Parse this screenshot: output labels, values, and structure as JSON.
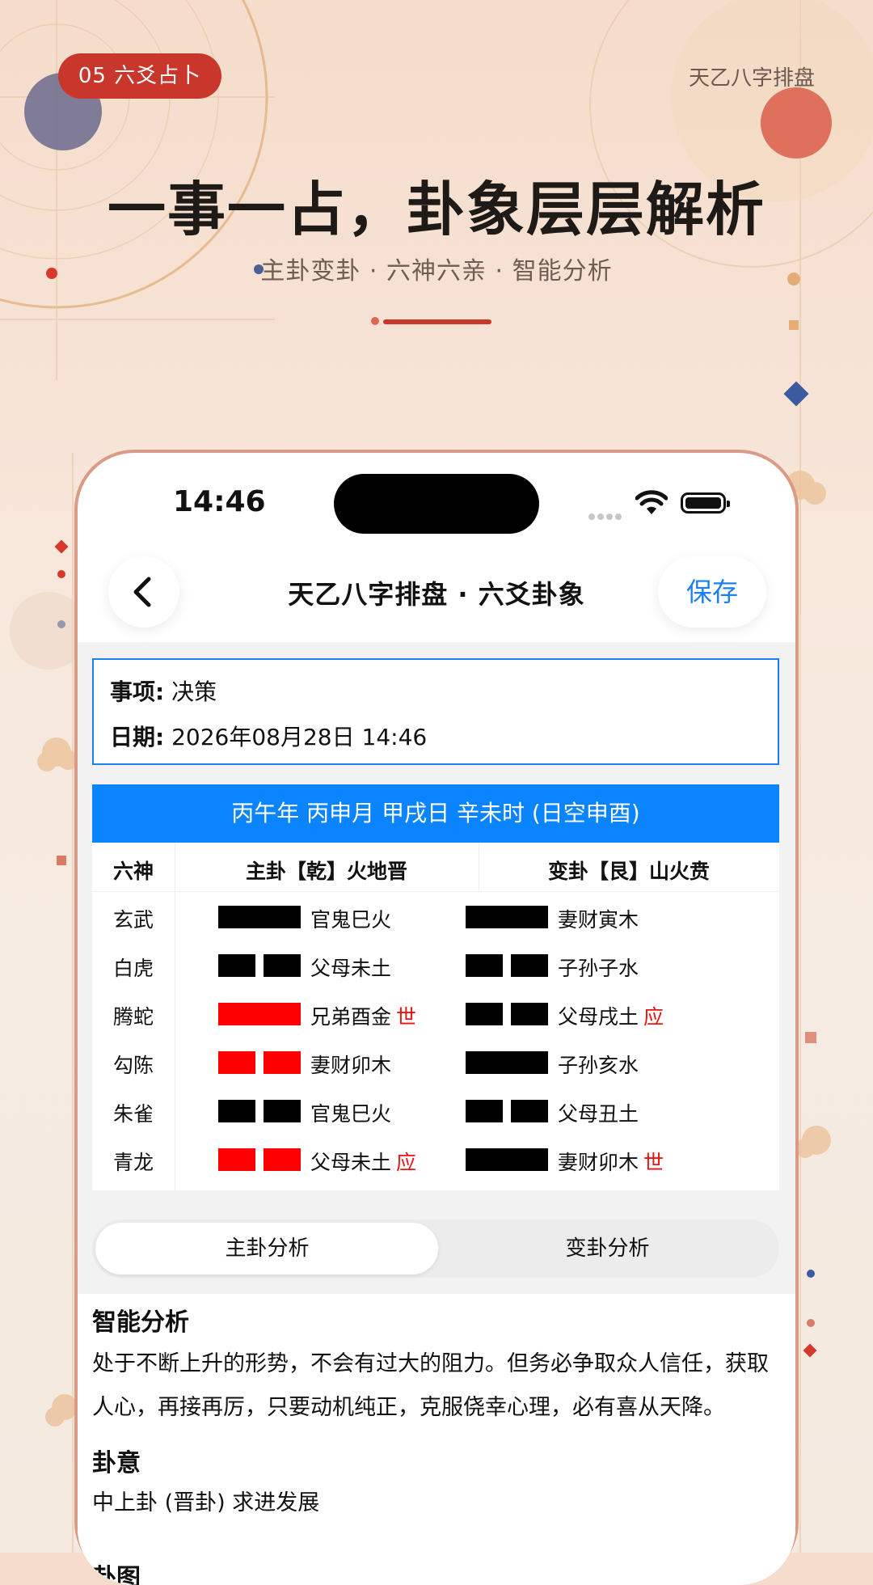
{
  "poster": {
    "tag": "05  六爻占卜",
    "brand": "天乙八字排盘",
    "headline": "一事一占，卦象层层解析",
    "subline": "主卦变卦 ·  六神六亲 ·  智能分析"
  },
  "status_bar": {
    "time": "14:46"
  },
  "navbar": {
    "back_icon": "chevron-left-icon",
    "title": "天乙八字排盘 · 六爻卦象",
    "save_label": "保存"
  },
  "info": {
    "subject_label": "事项:",
    "subject_value": "决策",
    "date_label": "日期:",
    "date_value": "2026年08月28日 14:46"
  },
  "ganzhi": "丙午年 丙申月 甲戌日 辛未时 (日空申酉)",
  "table": {
    "headers": [
      "六神",
      "主卦【乾】火地晋",
      "变卦【艮】山火贲"
    ],
    "rows": [
      {
        "liushen": "玄武",
        "main": {
          "type": "yang",
          "color": "#000000",
          "label": "官鬼巳火",
          "mark": ""
        },
        "change": {
          "type": "yang",
          "color": "#000000",
          "label": "妻财寅木",
          "mark": ""
        }
      },
      {
        "liushen": "白虎",
        "main": {
          "type": "yin",
          "color": "#000000",
          "label": "父母未土",
          "mark": ""
        },
        "change": {
          "type": "yin",
          "color": "#000000",
          "label": "子孙子水",
          "mark": ""
        }
      },
      {
        "liushen": "腾蛇",
        "main": {
          "type": "yang",
          "color": "#ff0000",
          "label": "兄弟酉金",
          "mark": "世"
        },
        "change": {
          "type": "yin",
          "color": "#000000",
          "label": "父母戌土",
          "mark": "应"
        }
      },
      {
        "liushen": "勾陈",
        "main": {
          "type": "yin",
          "color": "#ff0000",
          "label": "妻财卯木",
          "mark": ""
        },
        "change": {
          "type": "yang",
          "color": "#000000",
          "label": "子孙亥水",
          "mark": ""
        }
      },
      {
        "liushen": "朱雀",
        "main": {
          "type": "yin",
          "color": "#000000",
          "label": "官鬼巳火",
          "mark": ""
        },
        "change": {
          "type": "yin",
          "color": "#000000",
          "label": "父母丑土",
          "mark": ""
        }
      },
      {
        "liushen": "青龙",
        "main": {
          "type": "yin",
          "color": "#ff0000",
          "label": "父母未土",
          "mark": "应"
        },
        "change": {
          "type": "yang",
          "color": "#000000",
          "label": "妻财卯木",
          "mark": "世"
        }
      }
    ]
  },
  "tabs": {
    "main": "主卦分析",
    "change": "变卦分析",
    "active": "main"
  },
  "analysis": {
    "smart_title": "智能分析",
    "smart_text": "处于不断上升的形势，不会有过大的阻力。但务必争取众人信任，获取人心，再接再厉，只要动机纯正，克服侥幸心理，必有喜从天降。",
    "meaning_title": "卦意",
    "meaning_text": "中上卦 (晋卦) 求进发展",
    "next_title": "卦图"
  },
  "colors": {
    "accent": "#c9372c",
    "blue": "#0a84ff",
    "link": "#1a7ff0",
    "changing_line": "#ff0000"
  }
}
